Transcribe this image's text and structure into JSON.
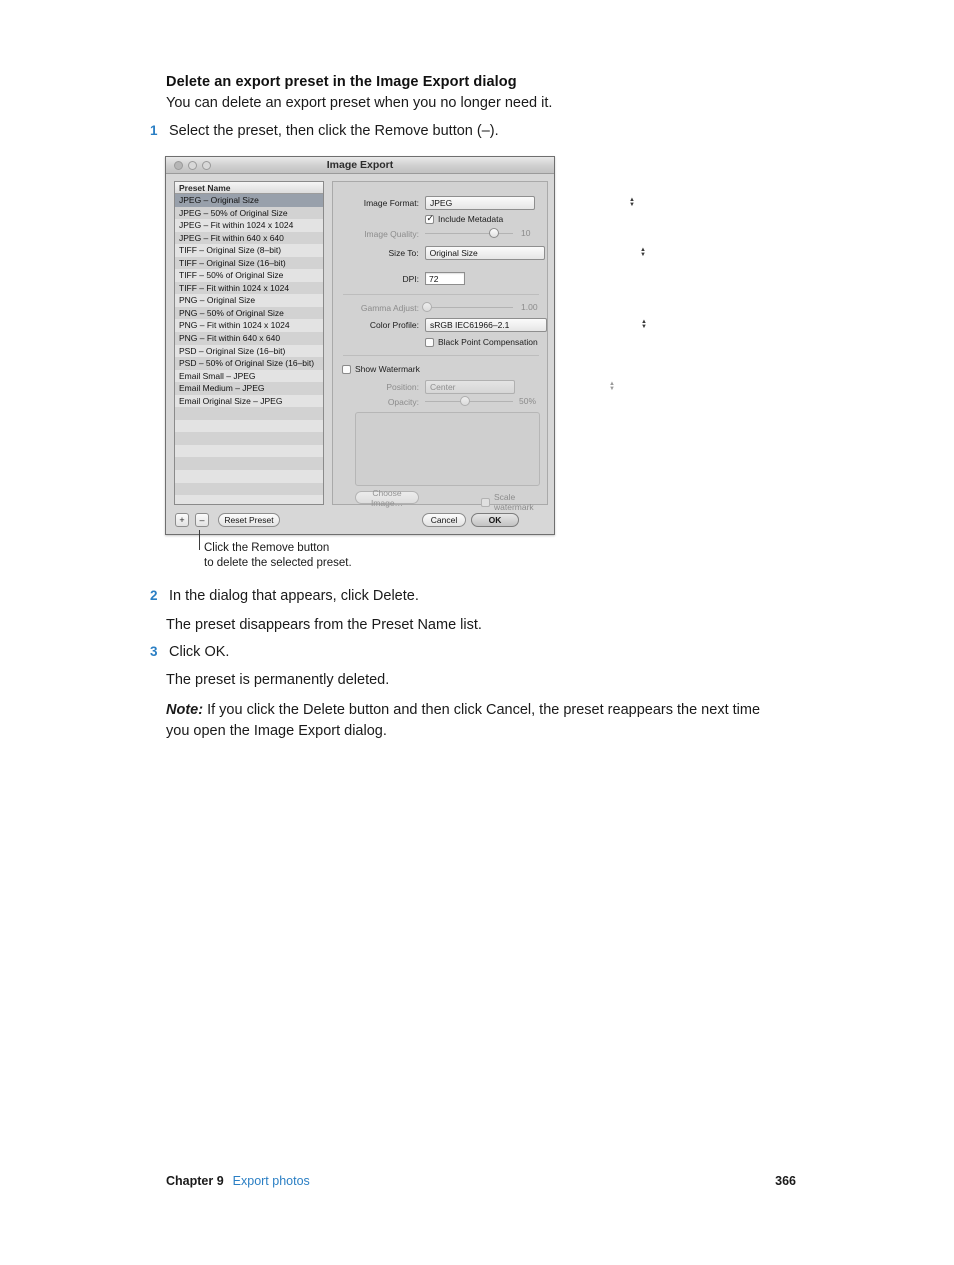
{
  "heading": "Delete an export preset in the Image Export dialog",
  "subhead": "You can delete an export preset when you no longer need it.",
  "steps": [
    {
      "num": "1",
      "text": "Select the preset, then click the Remove button (–)."
    },
    {
      "num": "2",
      "text": "In the dialog that appears, click Delete."
    },
    {
      "num": "3",
      "text": "Click OK."
    }
  ],
  "paragraphs": {
    "after_step2": "The preset disappears from the Preset Name list.",
    "after_step3": "The preset is permanently deleted.",
    "note_label": "Note:",
    "note_line1": "If you click the Delete button and then click Cancel, the preset reappears the next time",
    "note_line2": "you open the Image Export dialog."
  },
  "callout": {
    "line1": "Click the Remove button",
    "line2": "to delete the selected preset."
  },
  "dialog": {
    "title": "Image Export",
    "preset_list": {
      "column_header": "Preset Name",
      "selected_index": 0,
      "items": [
        "JPEG – Original Size",
        "JPEG – 50% of Original Size",
        "JPEG – Fit within 1024 x 1024",
        "JPEG – Fit within 640 x 640",
        "TIFF – Original Size (8–bit)",
        "TIFF – Original Size (16–bit)",
        "TIFF – 50% of Original Size",
        "TIFF – Fit within 1024 x 1024",
        "PNG – Original Size",
        "PNG – 50% of Original Size",
        "PNG – Fit within 1024 x 1024",
        "PNG – Fit within 640 x 640",
        "PSD – Original Size (16–bit)",
        "PSD – 50% of Original Size (16–bit)",
        "Email Small – JPEG",
        "Email Medium – JPEG",
        "Email Original Size – JPEG"
      ],
      "empty_row_count": 9
    },
    "fields": {
      "image_format_label": "Image Format:",
      "image_format_value": "JPEG",
      "include_metadata_label": "Include Metadata",
      "include_metadata_checked": true,
      "image_quality_label": "Image Quality:",
      "image_quality_value": "10",
      "image_quality_percent": 78,
      "size_to_label": "Size To:",
      "size_to_value": "Original Size",
      "dpi_label": "DPI:",
      "dpi_value": "72",
      "gamma_adjust_label": "Gamma Adjust:",
      "gamma_adjust_value": "1.00",
      "gamma_adjust_percent": 2,
      "color_profile_label": "Color Profile:",
      "color_profile_value": "sRGB IEC61966–2.1",
      "black_point_label": "Black Point Compensation",
      "black_point_checked": false,
      "show_watermark_label": "Show Watermark",
      "show_watermark_checked": false,
      "position_label": "Position:",
      "position_value": "Center",
      "opacity_label": "Opacity:",
      "opacity_value": "50%",
      "opacity_percent": 46,
      "choose_image_label": "Choose Image…",
      "scale_watermark_label": "Scale watermark",
      "scale_watermark_checked": false
    },
    "buttons": {
      "add_label": "+",
      "remove_label": "–",
      "reset_preset_label": "Reset Preset",
      "cancel_label": "Cancel",
      "ok_label": "OK"
    }
  },
  "footer": {
    "chapter": "Chapter 9",
    "link": "Export photos",
    "page_number": "366"
  },
  "colors": {
    "accent": "#2b7fc4",
    "selection": "#98a0ab",
    "dialog_bg": "#d7d7d7"
  }
}
